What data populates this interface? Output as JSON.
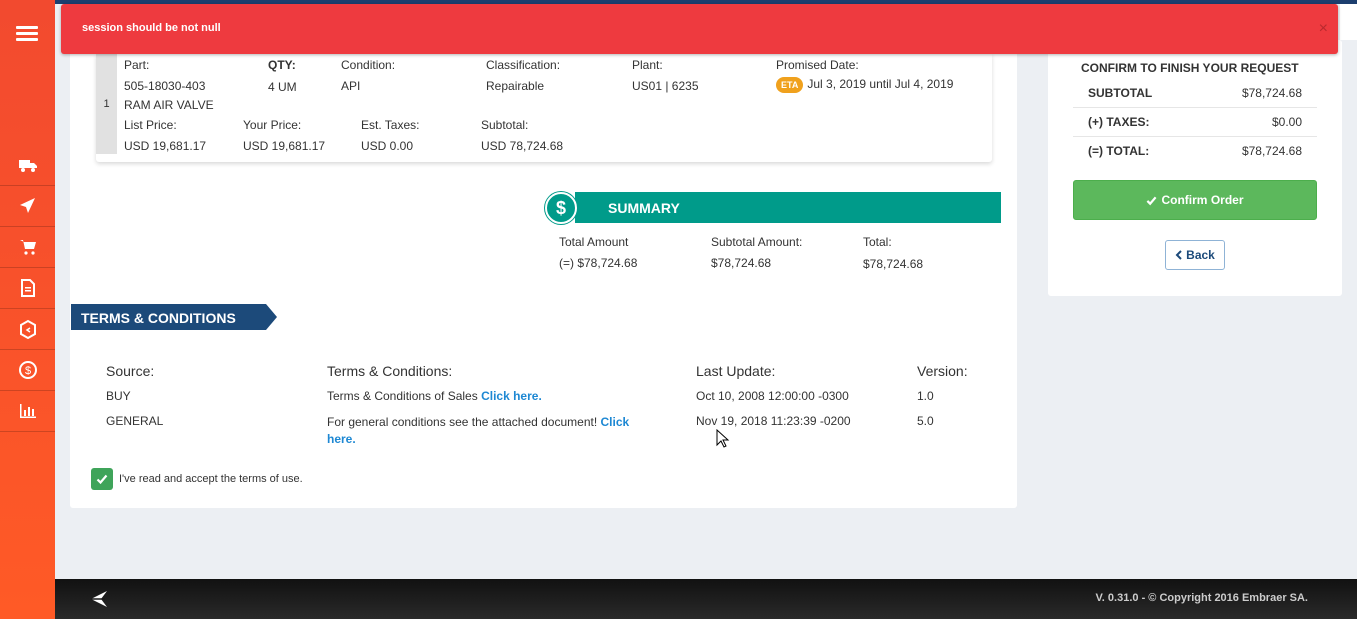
{
  "error": {
    "message": "session should be not null",
    "close": "×"
  },
  "item": {
    "number": "1",
    "part_label": "Part:",
    "part_number": "505-18030-403",
    "part_name": "RAM AIR VALVE",
    "qty_label": "QTY:",
    "qty_value": "4 UM",
    "condition_label": "Condition:",
    "condition_value": "API",
    "classification_label": "Classification:",
    "classification_value": "Repairable",
    "plant_label": "Plant:",
    "plant_value": "US01 | 6235",
    "promised_label": "Promised Date:",
    "eta_badge": "ETA",
    "promised_value": "Jul 3, 2019 until Jul 4, 2019",
    "list_price_label": "List Price:",
    "list_price_value": "USD 19,681.17",
    "your_price_label": "Your Price:",
    "your_price_value": "USD 19,681.17",
    "taxes_label": "Est. Taxes:",
    "taxes_value": "USD 0.00",
    "subtotal_label": "Subtotal:",
    "subtotal_value": "USD 78,724.68"
  },
  "summary": {
    "icon": "$",
    "title": "SUMMARY",
    "total_amount_label": "Total Amount",
    "total_amount_value": "(=) $78,724.68",
    "subtotal_label": "Subtotal Amount:",
    "subtotal_value": "$78,724.68",
    "total_label": "Total:",
    "total_value": "$78,724.68"
  },
  "terms": {
    "title": "TERMS & CONDITIONS",
    "headers": {
      "source": "Source:",
      "terms": "Terms & Conditions:",
      "last_update": "Last Update:",
      "version": "Version:"
    },
    "rows": [
      {
        "source": "BUY",
        "text": "Terms & Conditions of Sales ",
        "link": "Click here.",
        "link2": "",
        "last_update": "Oct 10, 2008 12:00:00 -0300",
        "version": "1.0"
      },
      {
        "source": "GENERAL",
        "text": "For general conditions see the attached document! ",
        "link": "Click",
        "link2": "here.",
        "last_update": "Nov 19, 2018 11:23:39 -0200",
        "version": "5.0"
      }
    ],
    "accept_label": "I've read and accept the terms of use."
  },
  "order_panel": {
    "title": "CONFIRM TO FINISH YOUR REQUEST",
    "subtotal_label": "SUBTOTAL",
    "subtotal_value": "$78,724.68",
    "taxes_label": "(+) TAXES:",
    "taxes_value": "$0.00",
    "total_label": "(=) TOTAL:",
    "total_value": "$78,724.68",
    "confirm_label": "Confirm Order",
    "back_label": "Back"
  },
  "footer": {
    "copyright": "V. 0.31.0 - © Copyright 2016 Embraer SA."
  },
  "colors": {
    "accent": "#ff5a26",
    "error": "#ee3a3f",
    "summary": "#009b8a",
    "terms": "#1c4a7a",
    "confirm": "#5cb85c",
    "link": "#1e88d3"
  },
  "sidebar_icons": [
    "menu-icon",
    "truck-icon",
    "plane-icon",
    "cart-icon",
    "document-icon",
    "box-icon",
    "dollar-cycle-icon",
    "bar-chart-icon"
  ]
}
